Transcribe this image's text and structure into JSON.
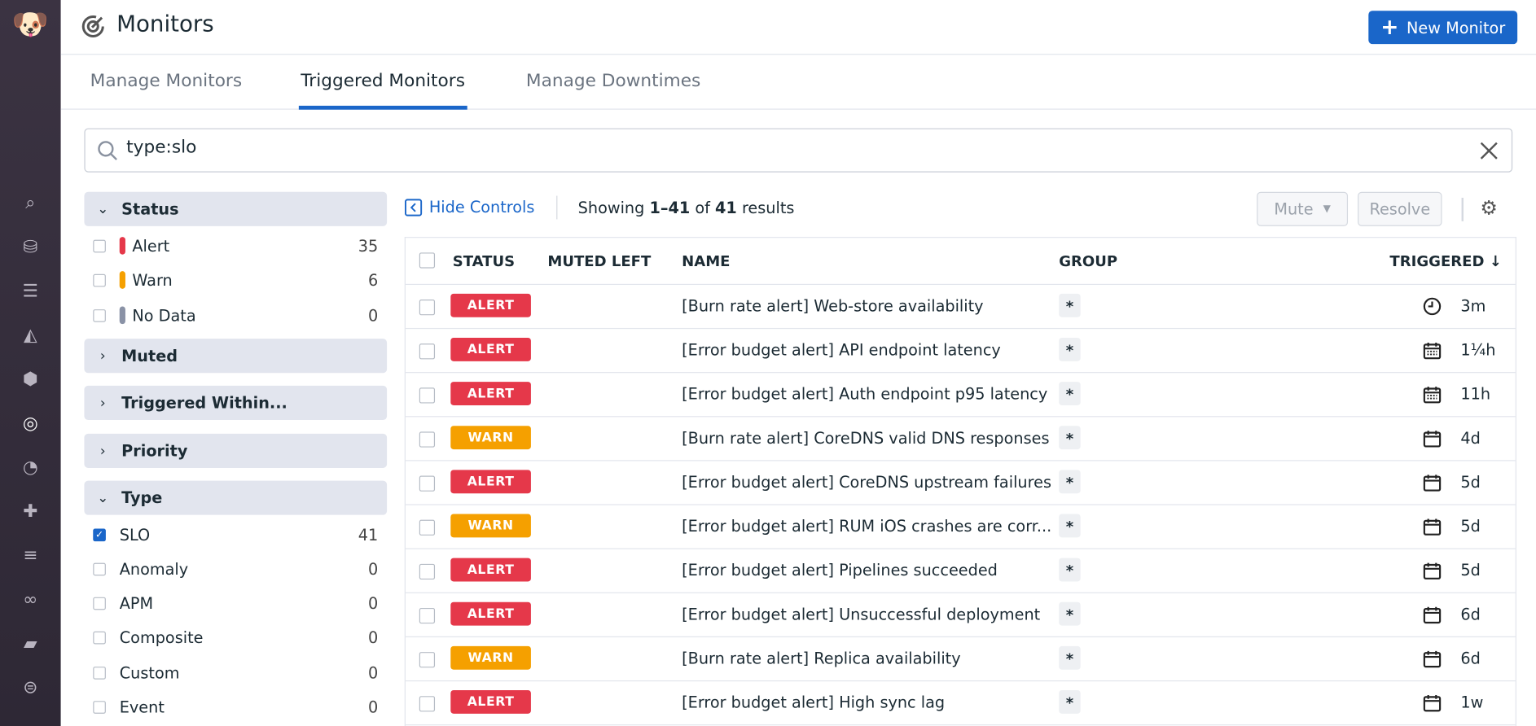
{
  "header": {
    "title": "Monitors",
    "new_monitor": "New Monitor"
  },
  "tabs": [
    "Manage Monitors",
    "Triggered Monitors",
    "Manage Downtimes"
  ],
  "search": {
    "value": "type:slo"
  },
  "facets": {
    "status": {
      "label": "Status",
      "items": [
        {
          "label": "Alert",
          "count": "35",
          "color": "#e5384a"
        },
        {
          "label": "Warn",
          "count": "6",
          "color": "#f5a000"
        },
        {
          "label": "No Data",
          "count": "0",
          "color": "#8a92a6"
        }
      ]
    },
    "muted": "Muted",
    "triggered_within": "Triggered Within...",
    "priority": "Priority",
    "type": {
      "label": "Type",
      "items": [
        {
          "label": "SLO",
          "count": "41",
          "checked": true
        },
        {
          "label": "Anomaly",
          "count": "0"
        },
        {
          "label": "APM",
          "count": "0"
        },
        {
          "label": "Composite",
          "count": "0"
        },
        {
          "label": "Custom",
          "count": "0"
        },
        {
          "label": "Event",
          "count": "0"
        }
      ]
    }
  },
  "toolbar": {
    "hide_controls": "Hide Controls",
    "showing_prefix": "Showing ",
    "range": "1–41",
    "of": " of ",
    "total": "41",
    "suffix": " results",
    "mute": "Mute",
    "resolve": "Resolve"
  },
  "table": {
    "columns": [
      "STATUS",
      "MUTED LEFT",
      "NAME",
      "GROUP",
      "TRIGGERED ↓"
    ],
    "rows": [
      {
        "status": "ALERT",
        "name": "[Burn rate alert] Web-store availability",
        "group": "*",
        "icon": "clock",
        "time": "3m"
      },
      {
        "status": "ALERT",
        "name": "[Error budget alert] API endpoint latency",
        "group": "*",
        "icon": "calendar-full",
        "time": "1¼h"
      },
      {
        "status": "ALERT",
        "name": "[Error budget alert] Auth endpoint p95 latency",
        "group": "*",
        "icon": "calendar-full",
        "time": "11h"
      },
      {
        "status": "WARN",
        "name": "[Burn rate alert] CoreDNS valid DNS responses",
        "group": "*",
        "icon": "calendar",
        "time": "4d"
      },
      {
        "status": "ALERT",
        "name": "[Error budget alert] CoreDNS upstream failures",
        "group": "*",
        "icon": "calendar",
        "time": "5d"
      },
      {
        "status": "WARN",
        "name": "[Error budget alert] RUM iOS crashes are corr...",
        "group": "*",
        "icon": "calendar",
        "time": "5d"
      },
      {
        "status": "ALERT",
        "name": "[Error budget alert] Pipelines succeeded",
        "group": "*",
        "icon": "calendar",
        "time": "5d"
      },
      {
        "status": "ALERT",
        "name": "[Error budget alert] Unsuccessful deployment",
        "group": "*",
        "icon": "calendar",
        "time": "6d"
      },
      {
        "status": "WARN",
        "name": "[Burn rate alert] Replica availability",
        "group": "*",
        "icon": "calendar",
        "time": "6d"
      },
      {
        "status": "ALERT",
        "name": "[Error budget alert] High sync lag",
        "group": "*",
        "icon": "calendar",
        "time": "1w"
      }
    ]
  },
  "colors": {
    "alert": "#e5384a",
    "warn": "#f5a000",
    "accent": "#1a66c9"
  }
}
